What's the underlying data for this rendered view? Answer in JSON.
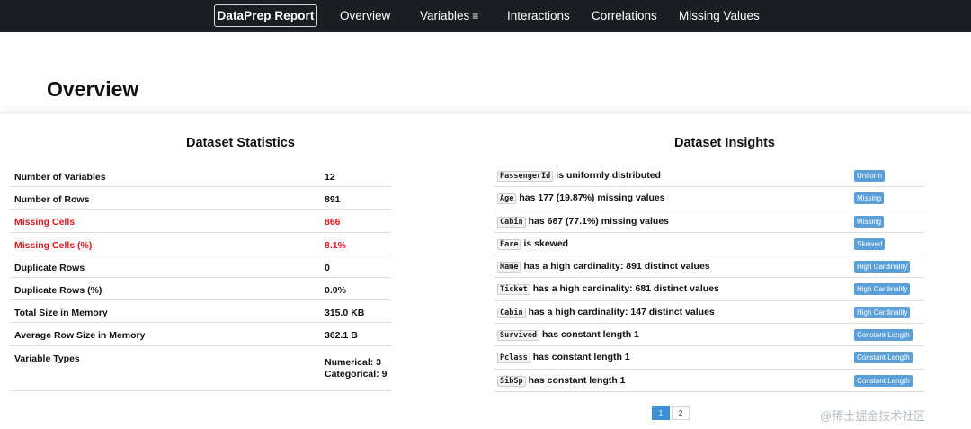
{
  "nav": {
    "brand": "DataPrep Report",
    "items": [
      "Overview",
      "Variables",
      "Interactions",
      "Correlations",
      "Missing Values"
    ],
    "variables_menu_icon": "≡"
  },
  "page": {
    "title": "Overview"
  },
  "statistics": {
    "title": "Dataset Statistics",
    "alert_color": "#e8151b",
    "rows": [
      {
        "label": "Number of Variables",
        "value": "12"
      },
      {
        "label": "Number of Rows",
        "value": "891"
      },
      {
        "label": "Missing Cells",
        "value": "866"
      },
      {
        "label": "Missing Cells (%)",
        "value": "8.1%"
      },
      {
        "label": "Duplicate Rows",
        "value": "0"
      },
      {
        "label": "Duplicate Rows (%)",
        "value": "0.0%"
      },
      {
        "label": "Total Size in Memory",
        "value": "315.0 KB"
      },
      {
        "label": "Average Row Size in Memory",
        "value": "362.1 B"
      },
      {
        "label": "Variable Types",
        "value_line1": "Numerical: 3",
        "value_line2": "Categorical: 9"
      }
    ]
  },
  "insights": {
    "title": "Dataset Insights",
    "tag_color": "#5b9fd8",
    "rows": [
      {
        "column": "PassengerId",
        "text": "is uniformly distributed",
        "tag": "Uniform"
      },
      {
        "column": "Age",
        "text": "has 177 (19.87%) missing values",
        "tag": "Missing"
      },
      {
        "column": "Cabin",
        "text": "has 687 (77.1%) missing values",
        "tag": "Missing"
      },
      {
        "column": "Fare",
        "text": "is skewed",
        "tag": "Skewed"
      },
      {
        "column": "Name",
        "text": "has a high cardinality: 891 distinct values",
        "tag": "High Cardinality"
      },
      {
        "column": "Ticket",
        "text": "has a high cardinality: 681 distinct values",
        "tag": "High Cardinality"
      },
      {
        "column": "Cabin",
        "text": "has a high cardinality: 147 distinct values",
        "tag": "High Cardinality"
      },
      {
        "column": "Survived",
        "text": "has constant length 1",
        "tag": "Constant Length"
      },
      {
        "column": "Pclass",
        "text": "has constant length 1",
        "tag": "Constant Length"
      },
      {
        "column": "SibSp",
        "text": "has constant length 1",
        "tag": "Constant Length"
      }
    ]
  },
  "pagination": {
    "pages": [
      "1",
      "2"
    ],
    "current": "1"
  },
  "watermark": "@稀土掘金技术社区"
}
